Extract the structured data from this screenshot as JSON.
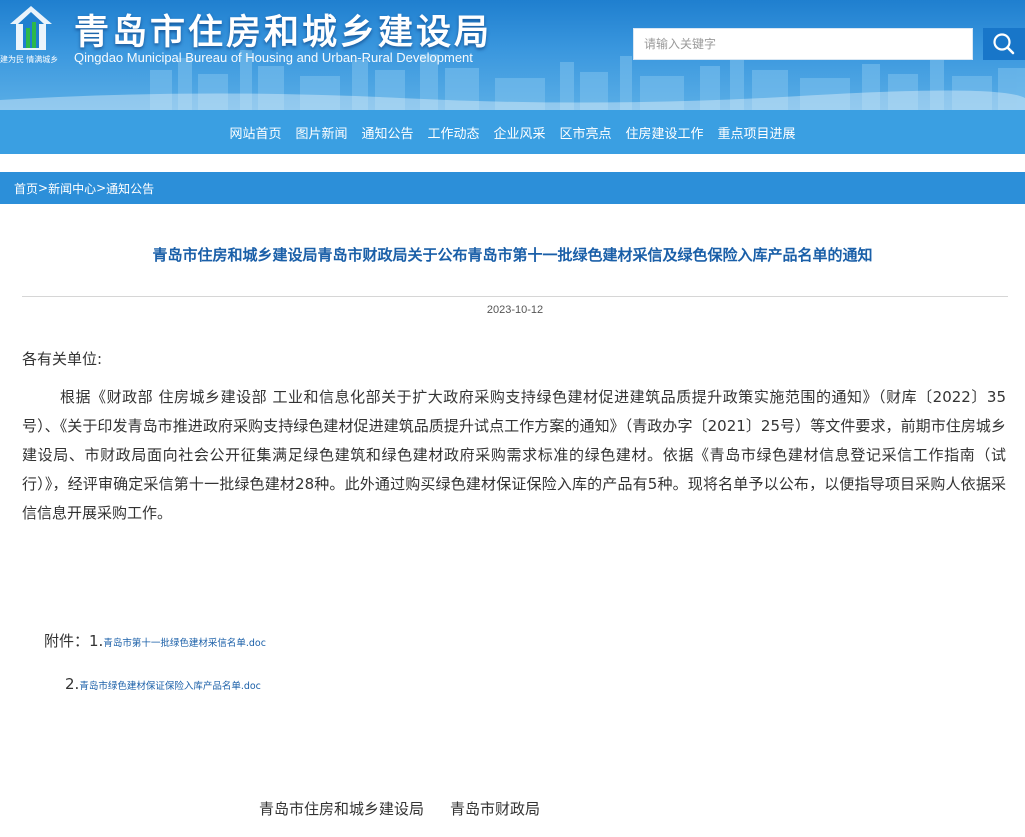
{
  "colors": {
    "banner": "#2d8cd8",
    "nav": "#3a9fe2",
    "breadcrumb_bar": "#2c8fd9",
    "title": "#1a5fa8",
    "link": "#1a5fa8"
  },
  "header": {
    "title": "青岛市住房和城乡建设局",
    "subtitle": "Qingdao Municipal Bureau of Housing and Urban-Rural Development",
    "slogan": "建为民 情满城乡",
    "search": {
      "placeholder": "请输入关键字",
      "icon": "search-icon"
    }
  },
  "nav": {
    "items": [
      {
        "label": "网站首页"
      },
      {
        "label": "图片新闻"
      },
      {
        "label": "通知公告"
      },
      {
        "label": "工作动态"
      },
      {
        "label": "企业风采"
      },
      {
        "label": "区市亮点"
      },
      {
        "label": "住房建设工作"
      },
      {
        "label": "重点项目进展"
      }
    ]
  },
  "breadcrumb": {
    "items": [
      "首页",
      "新闻中心",
      "通知公告"
    ],
    "separator": ">"
  },
  "article": {
    "title": "青岛市住房和城乡建设局青岛市财政局关于公布青岛市第十一批绿色建材采信及绿色保险入库产品名单的通知",
    "date": "2023-10-12",
    "salutation": "各有关单位:",
    "body": "根据《财政部 住房城乡建设部 工业和信息化部关于扩大政府采购支持绿色建材促进建筑品质提升政策实施范围的通知》（财库〔2022〕35号）、《关于印发青岛市推进政府采购支持绿色建材促进建筑品质提升试点工作方案的通知》（青政办字〔2021〕25号）等文件要求，前期市住房城乡建设局、市财政局面向社会公开征集满足绿色建筑和绿色建材政府采购需求标准的绿色建材。依据《青岛市绿色建材信息登记采信工作指南（试行）》，经评审确定采信第十一批绿色建材28种。此外通过购买绿色建材保证保险入库的产品有5种。现将名单予以公布，以便指导项目采购人依据采信信息开展采购工作。",
    "attachments_label": "附件：",
    "attachments": [
      {
        "index": "1.",
        "name": "青岛市第十一批绿色建材采信名单.doc"
      },
      {
        "index": "2.",
        "name": "青岛市绿色建材保证保险入库产品名单.doc"
      }
    ],
    "signatories": [
      "青岛市住房和城乡建设局",
      "青岛市财政局"
    ]
  }
}
